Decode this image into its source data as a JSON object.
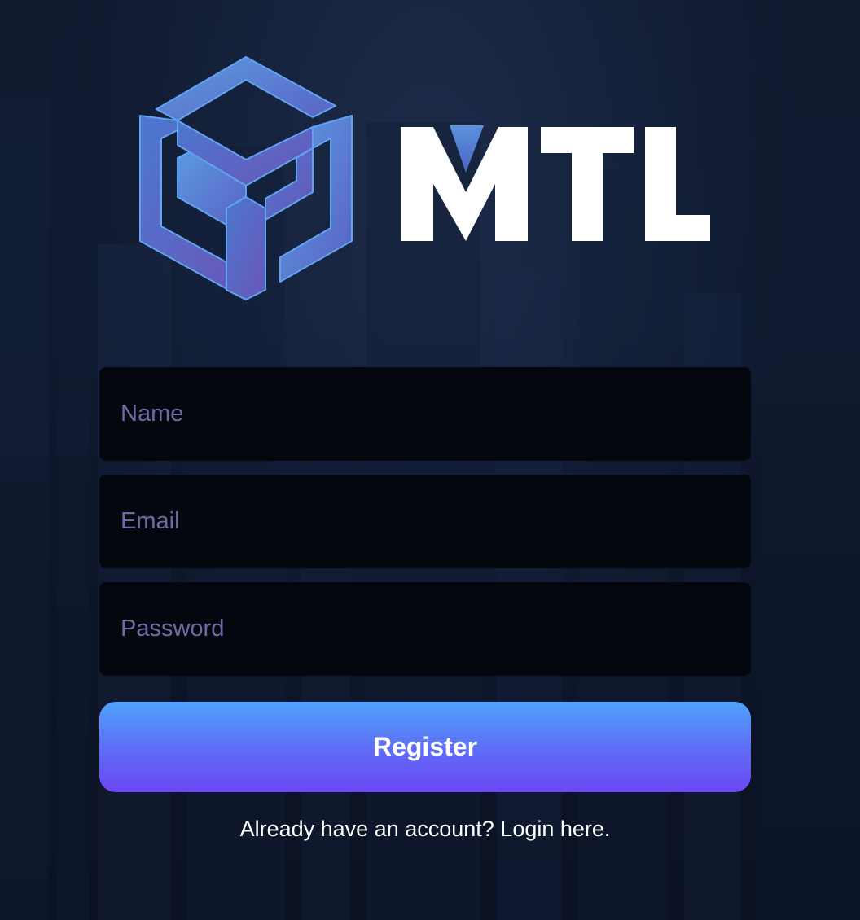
{
  "brand": {
    "name": "MTL",
    "colors": {
      "cube_light": "#5c9be2",
      "cube_dark": "#6a55b8",
      "v_accent": "#4f7fd0",
      "wordmark": "#ffffff"
    }
  },
  "form": {
    "name_placeholder": "Name",
    "email_placeholder": "Email",
    "password_placeholder": "Password",
    "register_label": "Register"
  },
  "footer": {
    "prompt": "Already have an account?",
    "login_link": "Login here."
  },
  "colors": {
    "background": "#0e1528",
    "input_background": "#05070f",
    "placeholder": "#6f6aa6",
    "button_gradient_top": "#4fa2fb",
    "button_gradient_bottom": "#6c47f4"
  }
}
